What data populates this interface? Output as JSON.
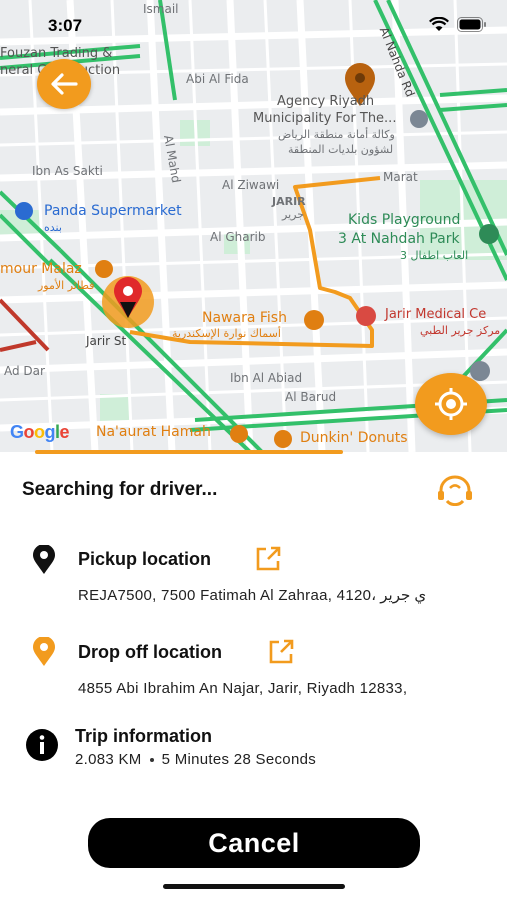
{
  "status_bar": {
    "time": "3:07"
  },
  "map": {
    "labels": {
      "ismail": "Ismail",
      "fouzan": "Fouzan Trading &",
      "general_construction": "neral Construction",
      "abi_al_fida": "Abi Al Fida",
      "agency_line1": "Agency Riyadh",
      "agency_line2": "Municipality For The...",
      "agency_arabic1": "وكالة أمانة منطقة الرياض",
      "agency_arabic2": "لشؤون بلديات المنطقة",
      "ibn_as_sakti": "Ibn As Sakti",
      "al_mahd": "Al Mahd",
      "marat": "Marat",
      "al_ziwawi": "Al Ziwawi",
      "jarir_en": "JARIR",
      "jarir_ar": "جرير",
      "panda": "Panda Supermarket",
      "panda_ar": "بنده",
      "kids_line1": "Kids Playground",
      "kids_line2": "3 At Nahdah Park",
      "kids_ar": "العاب اطفال 3",
      "al_gharib": "Al Gharib",
      "mour_malaz": "mour Malaz",
      "mour_malaz_ar": "فطائر الأمور",
      "nawara_fish": "Nawara Fish",
      "nawara_ar": "أسماك نوارة الإسكندرية",
      "jarir_medical": "Jarir Medical Ce",
      "jarir_medical_ar": "مركز جرير الطبي",
      "jarir_st": "Jarir St",
      "ad_dar": "Ad Dar",
      "ibn_al_abiad": "Ibn Al Abiad",
      "al_barud": "Al Barud",
      "al_nahda_rd": "Al Nahda Rd",
      "naaurat_hamah": "Na'aurat Hamah",
      "dunkin": "Dunkin' Donuts",
      "google": "Google"
    }
  },
  "sheet": {
    "title": "Searching for driver...",
    "pickup": {
      "title": "Pickup location",
      "address": "REJA7500, 7500 Fatimah Al Zahraa, 4120، ي جرير"
    },
    "dropoff": {
      "title": "Drop off location",
      "address": "4855 Abi Ibrahim An Najar, Jarir, Riyadh 12833,"
    },
    "trip": {
      "title": "Trip information",
      "distance": "2.083 KM",
      "duration": "5 Minutes 28 Seconds"
    },
    "cancel_label": "Cancel"
  },
  "colors": {
    "accent": "#f29b1e",
    "route": "#f29b1e",
    "road_green": "#33c06a",
    "button_dark": "#000000"
  }
}
